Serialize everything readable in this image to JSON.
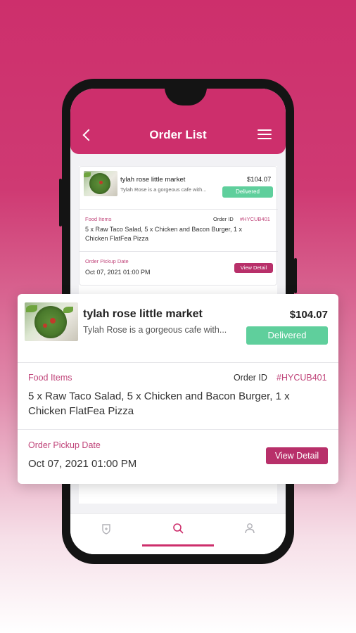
{
  "app": {
    "header_title": "Order List"
  },
  "order": {
    "store_name": "tylah rose little market",
    "description": "Tylah Rose is a gorgeous cafe with...",
    "price": "$104.07",
    "status": "Delivered",
    "food_items_label": "Food Items",
    "order_id_label": "Order ID",
    "order_id": "#HYCUB401",
    "food_items_line1": "5 x Raw Taco Salad, 5 x Chicken and Bacon Burger, 1 x",
    "food_items_line2": "Chicken FlatFea Pizza",
    "pickup_label": "Order Pickup Date",
    "pickup_date": "Oct 07, 2021 01:00 PM",
    "view_detail": "View Detail"
  },
  "tabs": [
    {
      "icon": "shield-icon",
      "active": false
    },
    {
      "icon": "search-icon",
      "active": true
    },
    {
      "icon": "user-icon",
      "active": false
    }
  ],
  "colors": {
    "brand": "#cd2f6c",
    "delivered": "#5fcf9c",
    "button": "#b8306a",
    "label": "#c0457a"
  }
}
